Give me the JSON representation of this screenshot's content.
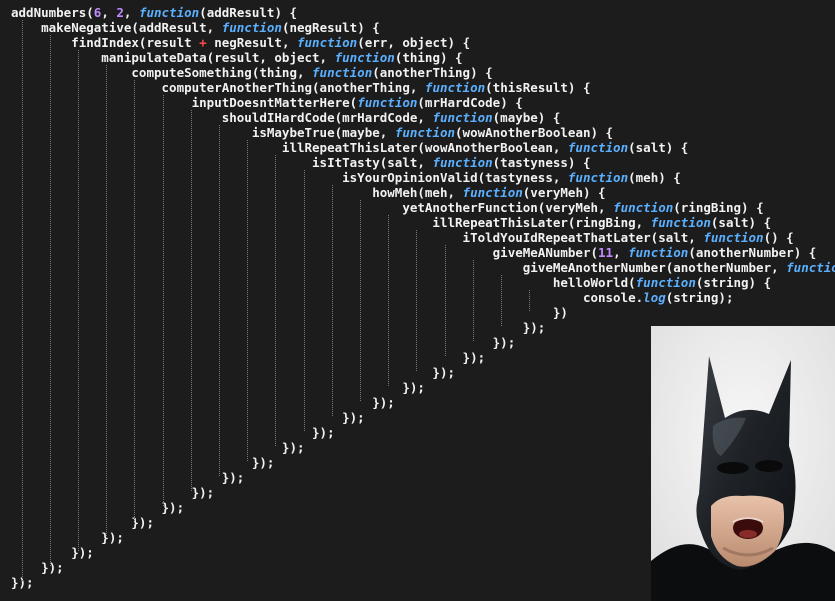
{
  "meme": {
    "code_lines": [
      [
        {
          "t": "addNumbers(",
          "k": "plain"
        },
        {
          "t": "6",
          "k": "num"
        },
        {
          "t": ", ",
          "k": "plain"
        },
        {
          "t": "2",
          "k": "num"
        },
        {
          "t": ", ",
          "k": "plain"
        },
        {
          "t": "function",
          "k": "fn"
        },
        {
          "t": "(addResult) {",
          "k": "plain"
        }
      ],
      [
        {
          "t": "    makeNegative(addResult, ",
          "k": "plain"
        },
        {
          "t": "function",
          "k": "fn"
        },
        {
          "t": "(negResult) {",
          "k": "plain"
        }
      ],
      [
        {
          "t": "        findIndex(result ",
          "k": "plain"
        },
        {
          "t": "+",
          "k": "op"
        },
        {
          "t": " negResult, ",
          "k": "plain"
        },
        {
          "t": "function",
          "k": "fn"
        },
        {
          "t": "(err, object) {",
          "k": "plain"
        }
      ],
      [
        {
          "t": "            manipulateData(result, object, ",
          "k": "plain"
        },
        {
          "t": "function",
          "k": "fn"
        },
        {
          "t": "(thing) {",
          "k": "plain"
        }
      ],
      [
        {
          "t": "                computeSomething(thing, ",
          "k": "plain"
        },
        {
          "t": "function",
          "k": "fn"
        },
        {
          "t": "(anotherThing) {",
          "k": "plain"
        }
      ],
      [
        {
          "t": "                    computerAnotherThing(anotherThing, ",
          "k": "plain"
        },
        {
          "t": "function",
          "k": "fn"
        },
        {
          "t": "(thisResult) {",
          "k": "plain"
        }
      ],
      [
        {
          "t": "                        inputDoesntMatterHere(",
          "k": "plain"
        },
        {
          "t": "function",
          "k": "fn"
        },
        {
          "t": "(mrHardCode) {",
          "k": "plain"
        }
      ],
      [
        {
          "t": "                            shouldIHardCode(mrHardCode, ",
          "k": "plain"
        },
        {
          "t": "function",
          "k": "fn"
        },
        {
          "t": "(maybe) {",
          "k": "plain"
        }
      ],
      [
        {
          "t": "                                isMaybeTrue(maybe, ",
          "k": "plain"
        },
        {
          "t": "function",
          "k": "fn"
        },
        {
          "t": "(wowAnotherBoolean) {",
          "k": "plain"
        }
      ],
      [
        {
          "t": "                                    illRepeatThisLater(wowAnotherBoolean, ",
          "k": "plain"
        },
        {
          "t": "function",
          "k": "fn"
        },
        {
          "t": "(salt) {",
          "k": "plain"
        }
      ],
      [
        {
          "t": "                                        isItTasty(salt, ",
          "k": "plain"
        },
        {
          "t": "function",
          "k": "fn"
        },
        {
          "t": "(tastyness) {",
          "k": "plain"
        }
      ],
      [
        {
          "t": "                                            isYourOpinionValid(tastyness, ",
          "k": "plain"
        },
        {
          "t": "function",
          "k": "fn"
        },
        {
          "t": "(meh) {",
          "k": "plain"
        }
      ],
      [
        {
          "t": "                                                howMeh(meh, ",
          "k": "plain"
        },
        {
          "t": "function",
          "k": "fn"
        },
        {
          "t": "(veryMeh) {",
          "k": "plain"
        }
      ],
      [
        {
          "t": "                                                    yetAnotherFunction(veryMeh, ",
          "k": "plain"
        },
        {
          "t": "function",
          "k": "fn"
        },
        {
          "t": "(ringBing) {",
          "k": "plain"
        }
      ],
      [
        {
          "t": "                                                        illRepeatThisLater(ringBing, ",
          "k": "plain"
        },
        {
          "t": "function",
          "k": "fn"
        },
        {
          "t": "(salt) {",
          "k": "plain"
        }
      ],
      [
        {
          "t": "                                                            iToldYouIdRepeatThatLater(salt, ",
          "k": "plain"
        },
        {
          "t": "function",
          "k": "fn"
        },
        {
          "t": "() {",
          "k": "plain"
        }
      ],
      [
        {
          "t": "                                                                giveMeANumber(",
          "k": "plain"
        },
        {
          "t": "11",
          "k": "num"
        },
        {
          "t": ", ",
          "k": "plain"
        },
        {
          "t": "function",
          "k": "fn"
        },
        {
          "t": "(anotherNumber) {",
          "k": "plain"
        }
      ],
      [
        {
          "t": "                                                                    giveMeAnotherNumber(anotherNumber, ",
          "k": "plain"
        },
        {
          "t": "function",
          "k": "fn"
        },
        {
          "t": "() {",
          "k": "plain"
        }
      ],
      [
        {
          "t": "                                                                        helloWorld(",
          "k": "plain"
        },
        {
          "t": "function",
          "k": "fn"
        },
        {
          "t": "(string) {",
          "k": "plain"
        }
      ],
      [
        {
          "t": "                                                                            console.",
          "k": "plain"
        },
        {
          "t": "log",
          "k": "fn"
        },
        {
          "t": "(string);",
          "k": "plain"
        }
      ],
      [
        {
          "t": "                                                                        })",
          "k": "plain"
        }
      ],
      [
        {
          "t": "                                                                    });",
          "k": "plain"
        }
      ],
      [
        {
          "t": "                                                                });",
          "k": "plain"
        }
      ],
      [
        {
          "t": "                                                            });",
          "k": "plain"
        }
      ],
      [
        {
          "t": "                                                        });",
          "k": "plain"
        }
      ],
      [
        {
          "t": "                                                    });",
          "k": "plain"
        }
      ],
      [
        {
          "t": "                                                });",
          "k": "plain"
        }
      ],
      [
        {
          "t": "                                            });",
          "k": "plain"
        }
      ],
      [
        {
          "t": "                                        });",
          "k": "plain"
        }
      ],
      [
        {
          "t": "                                    });",
          "k": "plain"
        }
      ],
      [
        {
          "t": "                                });",
          "k": "plain"
        }
      ],
      [
        {
          "t": "                            });",
          "k": "plain"
        }
      ],
      [
        {
          "t": "                        });",
          "k": "plain"
        }
      ],
      [
        {
          "t": "                    });",
          "k": "plain"
        }
      ],
      [
        {
          "t": "                });",
          "k": "plain"
        }
      ],
      [
        {
          "t": "            });",
          "k": "plain"
        }
      ],
      [
        {
          "t": "        });",
          "k": "plain"
        }
      ],
      [
        {
          "t": "    });",
          "k": "plain"
        }
      ],
      [
        {
          "t": "});",
          "k": "plain"
        }
      ]
    ],
    "colors": {
      "background": "#1c1c1c",
      "plain": "#f2f2f2",
      "keyword_function": "#5ab0ff",
      "number": "#c08bff",
      "operator": "#ff4b4b",
      "indent_guide": "#7a7a7a"
    },
    "image": {
      "subject": "batman-shocked-face"
    }
  }
}
